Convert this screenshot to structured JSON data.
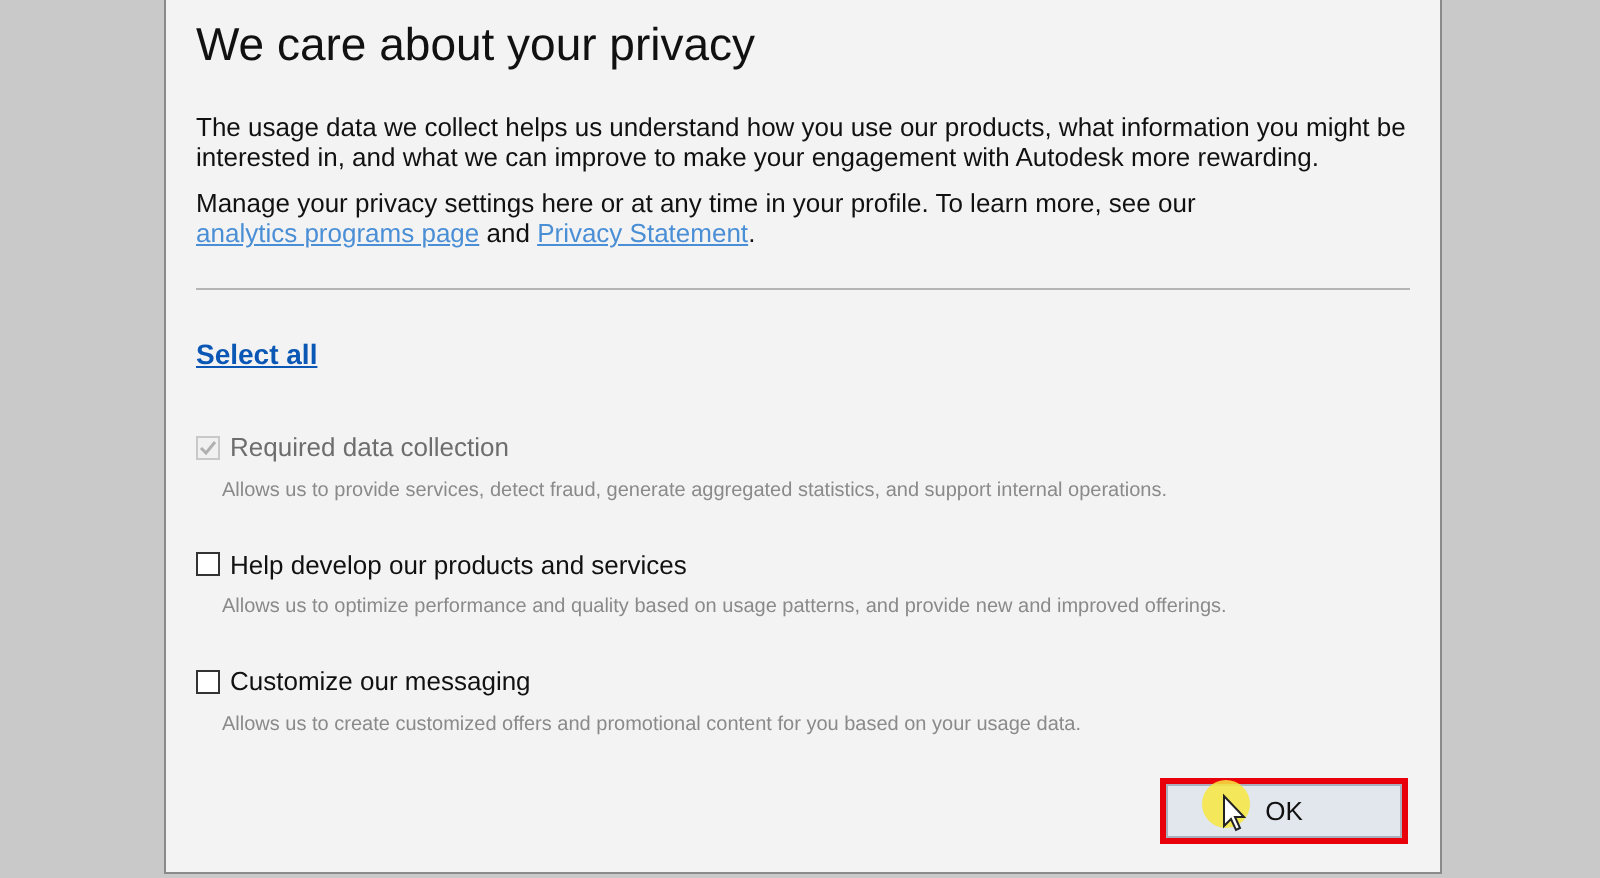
{
  "dialog": {
    "title": "We care about your privacy",
    "intro": "The usage data we collect helps us understand how you use our products, what information you might be interested in, and what we can improve to make your engagement with Autodesk more rewarding.",
    "manage": [
      {
        "kind": "text",
        "text": "Manage your privacy settings here or at any time in your profile. To learn more, see our "
      },
      {
        "kind": "link",
        "text": "analytics programs page"
      },
      {
        "kind": "text",
        "text": " and "
      },
      {
        "kind": "link",
        "text": "Privacy Statement"
      },
      {
        "kind": "text",
        "text": "."
      }
    ],
    "select_all": "Select all",
    "options": [
      {
        "label": "Required data collection",
        "description": "Allows us to provide services, detect fraud, generate aggregated statistics, and support internal operations.",
        "checked": true,
        "disabled": true
      },
      {
        "label": "Help develop our products and services",
        "description": "Allows us to optimize performance and quality based on usage patterns, and provide new and improved offerings.",
        "checked": false,
        "disabled": false
      },
      {
        "label": "Customize our messaging",
        "description": "Allows us to create customized offers and promotional content for you based on your usage data.",
        "checked": false,
        "disabled": false
      }
    ],
    "ok_button": {
      "label": "OK",
      "highlighted": true
    }
  }
}
